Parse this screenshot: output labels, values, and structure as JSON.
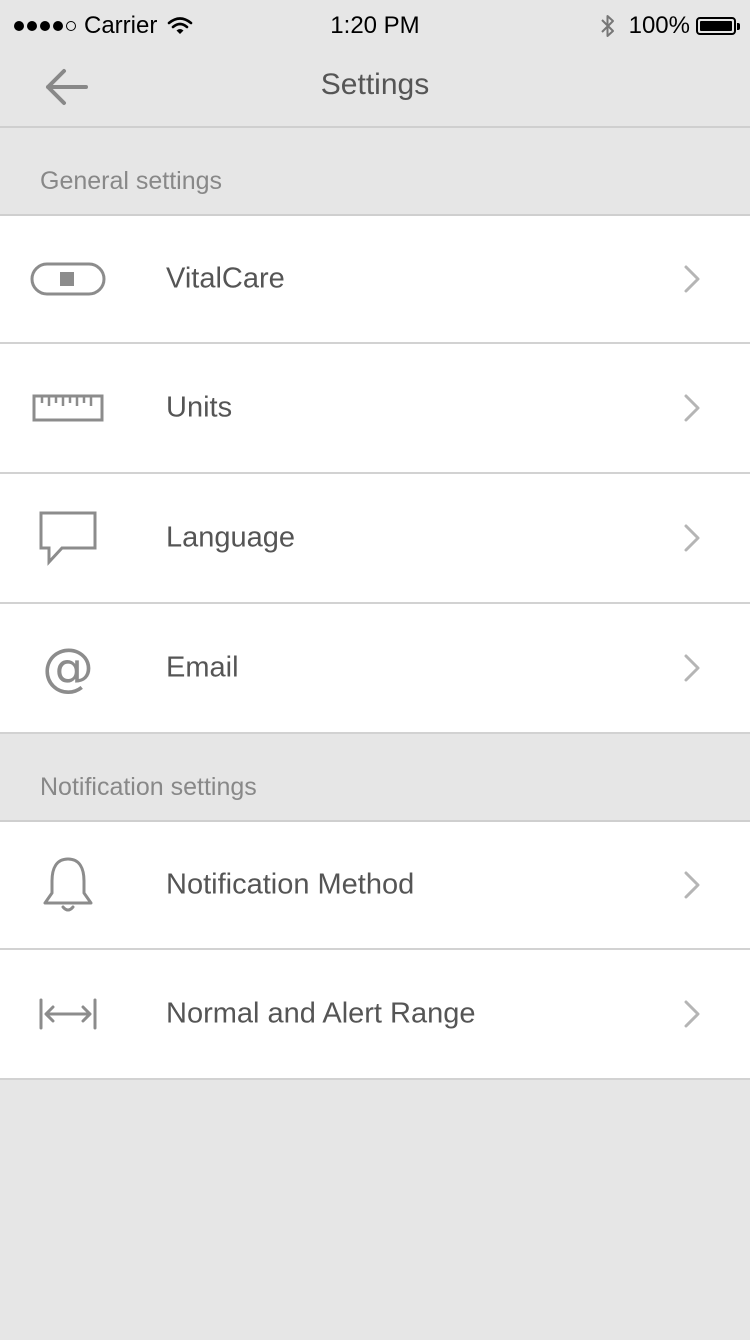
{
  "status_bar": {
    "carrier": "Carrier",
    "time": "1:20 PM",
    "battery": "100%"
  },
  "nav": {
    "title": "Settings"
  },
  "sections": [
    {
      "title": "General settings",
      "items": [
        {
          "label": "VitalCare",
          "icon": "device-icon"
        },
        {
          "label": "Units",
          "icon": "ruler-icon"
        },
        {
          "label": "Language",
          "icon": "speech-bubble-icon"
        },
        {
          "label": "Email",
          "icon": "at-sign-icon"
        }
      ]
    },
    {
      "title": "Notification settings",
      "items": [
        {
          "label": "Notification Method",
          "icon": "bell-icon"
        },
        {
          "label": "Normal and Alert Range",
          "icon": "range-icon"
        }
      ]
    }
  ],
  "colors": {
    "background": "#e6e6e6",
    "row_background": "#ffffff",
    "text": "#555555",
    "section_text": "#888888",
    "icon": "#8c8c8c",
    "chevron": "#b5b5b5"
  }
}
